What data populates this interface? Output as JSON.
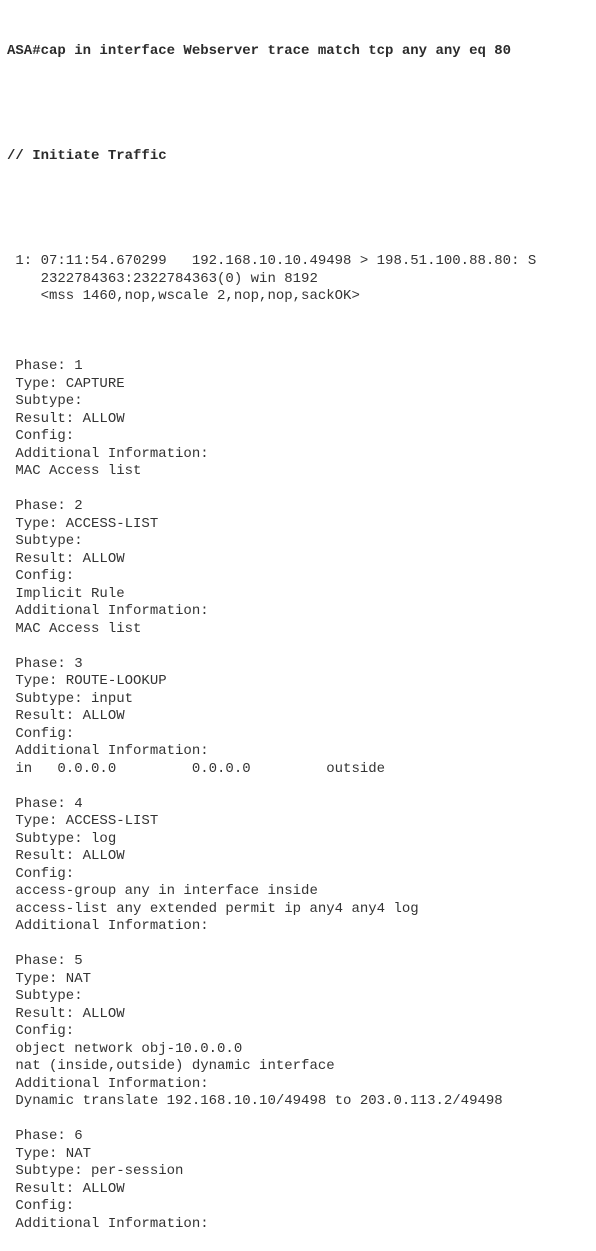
{
  "command": "ASA#cap in interface Webserver trace match tcp any any eq 80",
  "comment": "// Initiate Traffic",
  "packet": [
    " 1: 07:11:54.670299   192.168.10.10.49498 > 198.51.100.88.80: S",
    "    2322784363:2322784363(0) win 8192",
    "    <mss 1460,nop,wscale 2,nop,nop,sackOK>"
  ],
  "phases": [
    {
      "lines": [
        " Phase: 1",
        " Type: CAPTURE",
        " Subtype:",
        " Result: ALLOW",
        " Config:",
        " Additional Information:",
        " MAC Access list"
      ]
    },
    {
      "lines": [
        " Phase: 2",
        " Type: ACCESS-LIST",
        " Subtype:",
        " Result: ALLOW",
        " Config:",
        " Implicit Rule",
        " Additional Information:",
        " MAC Access list"
      ]
    },
    {
      "lines": [
        " Phase: 3",
        " Type: ROUTE-LOOKUP",
        " Subtype: input",
        " Result: ALLOW",
        " Config:",
        " Additional Information:",
        " in   0.0.0.0         0.0.0.0         outside"
      ]
    },
    {
      "lines": [
        " Phase: 4",
        " Type: ACCESS-LIST",
        " Subtype: log",
        " Result: ALLOW",
        " Config:",
        " access-group any in interface inside",
        " access-list any extended permit ip any4 any4 log",
        " Additional Information:"
      ]
    },
    {
      "lines": [
        " Phase: 5",
        " Type: NAT",
        " Subtype:",
        " Result: ALLOW",
        " Config:",
        " object network obj-10.0.0.0",
        " nat (inside,outside) dynamic interface",
        " Additional Information:",
        " Dynamic translate 192.168.10.10/49498 to 203.0.113.2/49498"
      ]
    },
    {
      "lines": [
        " Phase: 6",
        " Type: NAT",
        " Subtype: per-session",
        " Result: ALLOW",
        " Config:",
        " Additional Information:"
      ]
    }
  ]
}
